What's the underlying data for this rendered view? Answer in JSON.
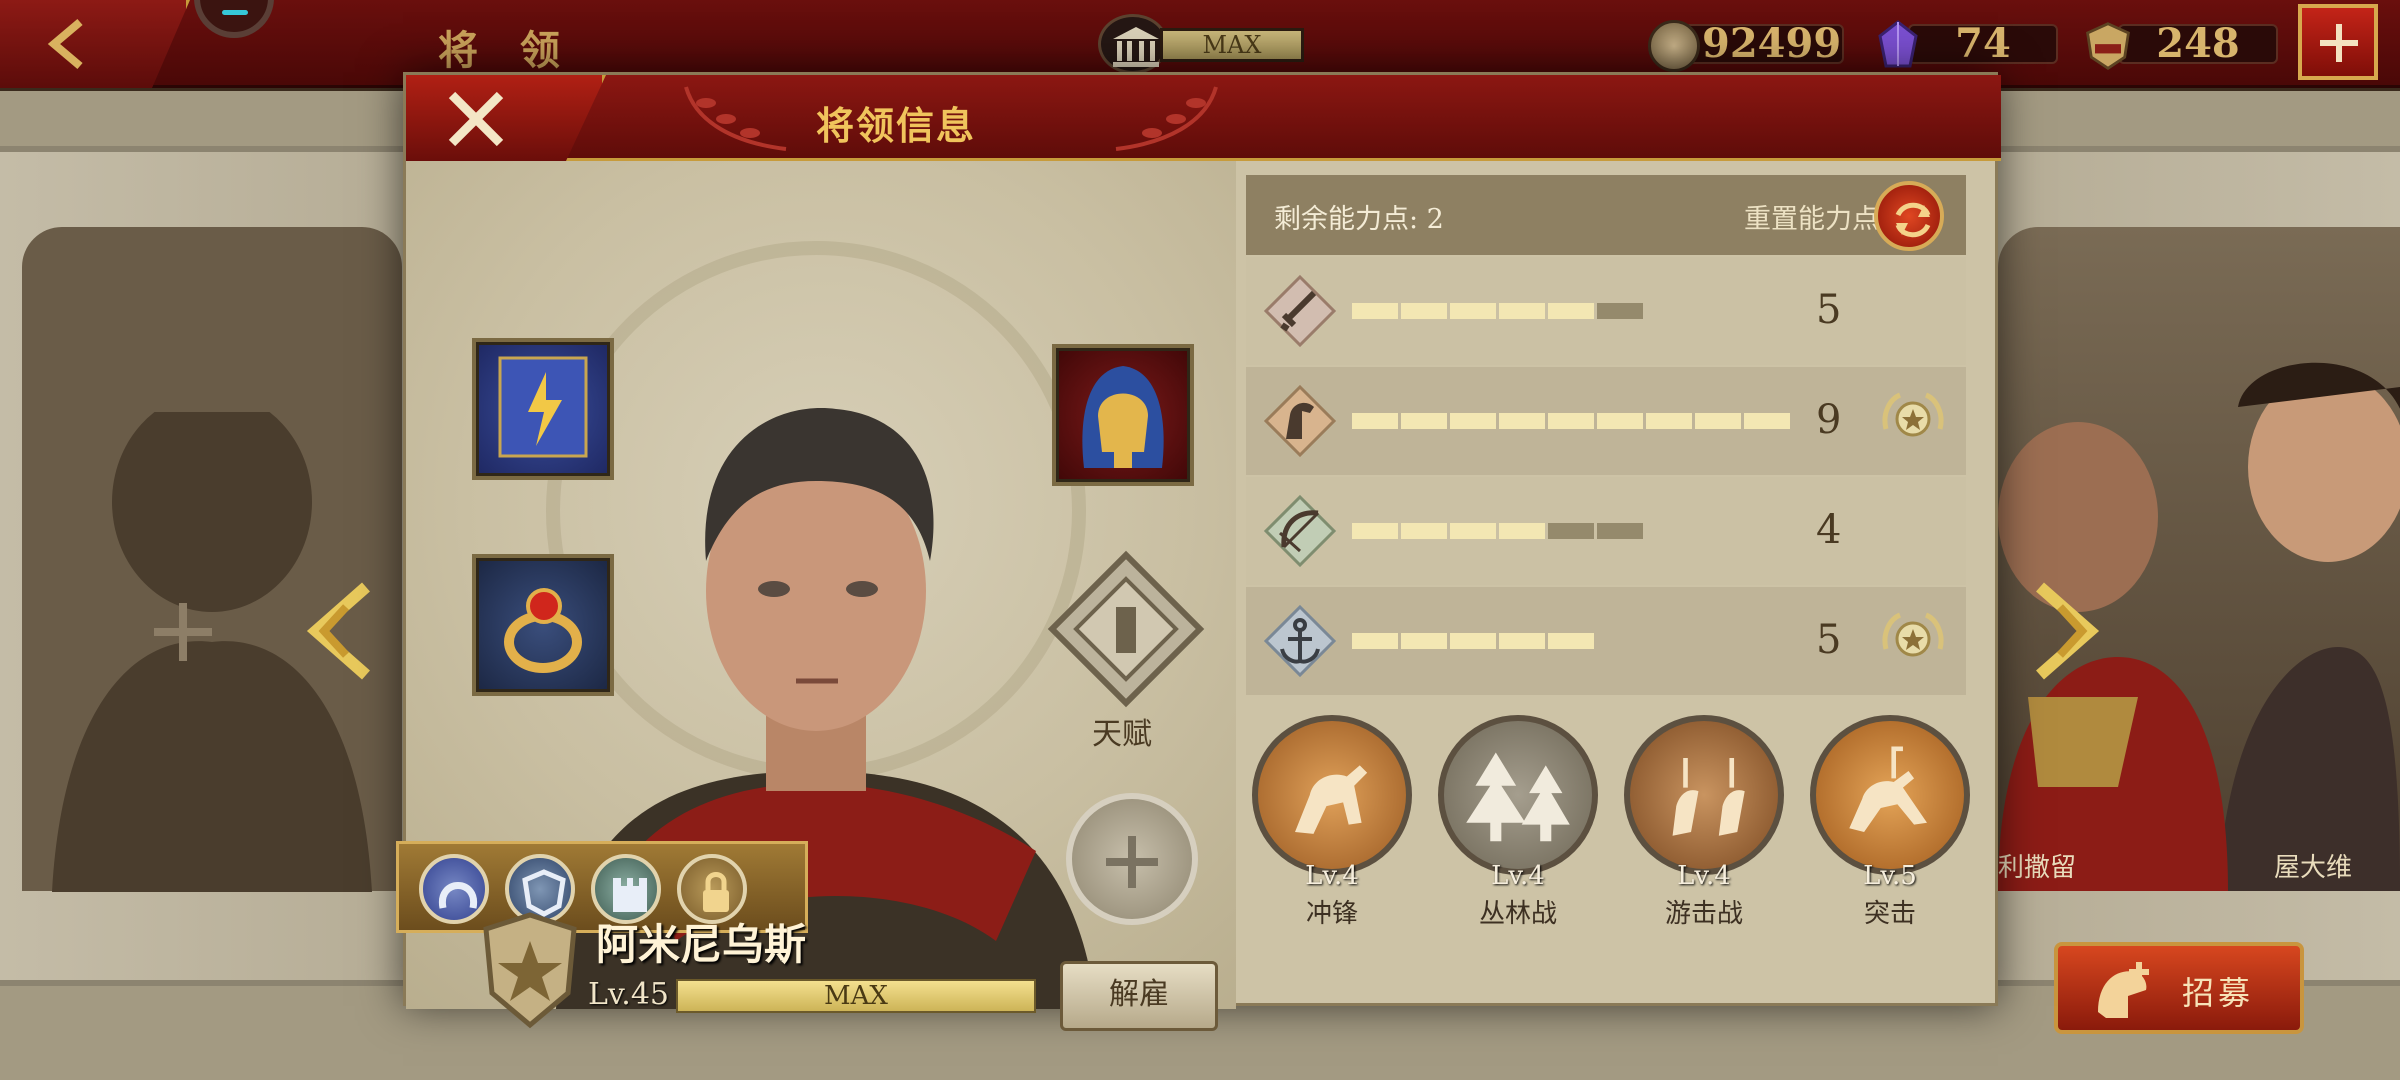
{
  "topbar": {
    "title": "将 领",
    "building_level": "MAX",
    "coins": "92499",
    "gems": "74",
    "spqr_tokens": "248",
    "icons": {
      "back": "back-arrow-icon",
      "building": "temple-icon",
      "coins": "coin-icon",
      "gems": "gem-icon",
      "spqr": "spqr-icon",
      "add": "plus-icon"
    }
  },
  "background": {
    "left_card_icon": "plus-icon",
    "right_card_names": [
      "利撒留",
      "屋大维"
    ],
    "recruit_label": "招募"
  },
  "modal": {
    "title": "将领信息",
    "talent_label": "天赋",
    "hero": {
      "name": "阿米尼乌斯",
      "level": "Lv.45",
      "level_bar": "MAX",
      "fire_label": "解雇"
    },
    "ability": {
      "remaining_label": "剩余能力点: 2",
      "reset_label": "重置能力点"
    },
    "stats": [
      {
        "icon": "sword-icon",
        "value": "5",
        "filled": 5,
        "total": 6,
        "medal": false
      },
      {
        "icon": "horse-icon",
        "value": "9",
        "filled": 9,
        "total": 9,
        "medal": true
      },
      {
        "icon": "bow-icon",
        "value": "4",
        "filled": 4,
        "total": 6,
        "medal": false
      },
      {
        "icon": "anchor-icon",
        "value": "5",
        "filled": 5,
        "total": 5,
        "medal": true
      }
    ],
    "skills": [
      {
        "level": "Lv.4",
        "name": "冲锋",
        "icon": "cavalry-charge-icon"
      },
      {
        "level": "Lv.4",
        "name": "丛林战",
        "icon": "forest-icon"
      },
      {
        "level": "Lv.4",
        "name": "游击战",
        "icon": "skirmish-icon"
      },
      {
        "level": "Lv.5",
        "name": "突击",
        "icon": "assault-icon"
      }
    ],
    "colors": {
      "header_red": "#7a1310",
      "gold": "#f0c45c",
      "panel": "#cdc3a6"
    }
  }
}
